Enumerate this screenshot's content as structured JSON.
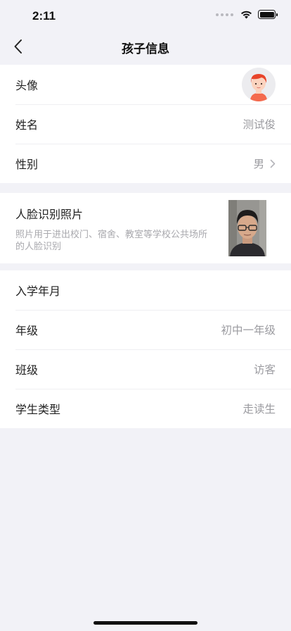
{
  "status": {
    "time": "2:11"
  },
  "nav": {
    "title": "孩子信息"
  },
  "profile": [
    {
      "label": "头像",
      "value": "",
      "kind": "avatar"
    },
    {
      "label": "姓名",
      "value": "测试俊"
    },
    {
      "label": "性别",
      "value": "男",
      "chevron": true
    }
  ],
  "face": {
    "label": "人脸识别照片",
    "description": "照片用于进出校门、宿舍、教室等学校公共场所的人脸识别"
  },
  "school": [
    {
      "label": "入学年月",
      "value": ""
    },
    {
      "label": "年级",
      "value": "初中一年级"
    },
    {
      "label": "班级",
      "value": "访客"
    },
    {
      "label": "学生类型",
      "value": "走读生"
    }
  ],
  "colors": {
    "background": "#f2f2f7",
    "card": "#ffffff",
    "muted": "#9b9ba0"
  }
}
